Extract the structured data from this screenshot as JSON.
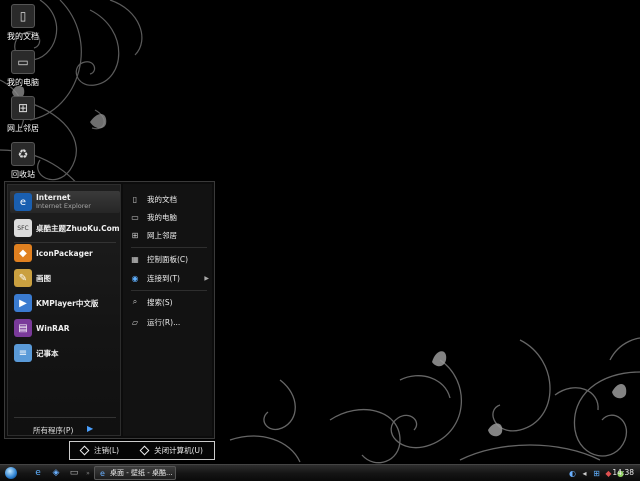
{
  "desktop": {
    "icons": [
      {
        "label": "我的文档",
        "icon": "my-documents-icon"
      },
      {
        "label": "我的电脑",
        "icon": "my-computer-icon"
      },
      {
        "label": "网上邻居",
        "icon": "network-places-icon"
      },
      {
        "label": "回收站",
        "icon": "recycle-bin-icon"
      }
    ]
  },
  "start_menu": {
    "pinned": [
      {
        "title": "Internet",
        "subtitle": "Internet Explorer",
        "icon": "internet-explorer-icon"
      },
      {
        "title": "桌酷主题ZhuoKu.Com",
        "icon": "zhuoku-theme-icon"
      }
    ],
    "recent": [
      {
        "title": "IconPackager",
        "icon": "iconpackager-icon"
      },
      {
        "title": "画图",
        "icon": "paint-icon"
      },
      {
        "title": "KMPlayer中文版",
        "icon": "kmplayer-icon"
      },
      {
        "title": "WinRAR",
        "icon": "winrar-icon"
      },
      {
        "title": "记事本",
        "icon": "notepad-icon"
      }
    ],
    "all_programs": "所有程序(P)",
    "places": [
      {
        "label": "我的文档",
        "icon": "my-documents-icon"
      },
      {
        "label": "我的电脑",
        "icon": "my-computer-icon"
      },
      {
        "label": "网上邻居",
        "icon": "network-places-icon"
      },
      {
        "label": "控制面板(C)",
        "icon": "control-panel-icon"
      },
      {
        "label": "连接到(T)",
        "icon": "connect-to-icon"
      },
      {
        "label": "搜索(S)",
        "icon": "search-icon"
      },
      {
        "label": "运行(R)...",
        "icon": "run-icon"
      }
    ],
    "logoff": "注销(L)",
    "shutdown": "关闭计算机(U)"
  },
  "taskbar": {
    "active_window": "桌面 - 壁纸 - 桌酷...",
    "clock": "14:38"
  },
  "colors": {
    "background": "#000000",
    "menu_bg": "#0c0c0c",
    "accent": "#4aa0ff"
  }
}
